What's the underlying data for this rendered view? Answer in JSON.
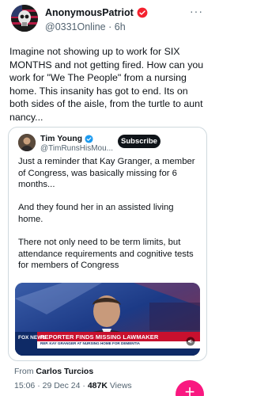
{
  "post": {
    "author_name": "AnonymousPatriot",
    "handle": "@0331Online",
    "separator": " · ",
    "time_ago": "6h",
    "text": "Imagine not showing up to work for SIX MONTHS and not getting fired. How can you work for \"We The People\" from a nursing home. This insanity has got to end. Its on both sides of the aisle, from the turtle to aunt nancy...",
    "more_icon": "more-icon",
    "verified_icon": "verified-red-badge-icon",
    "verified_color": "#f4212e"
  },
  "quote": {
    "author_name": "Tim Young",
    "handle": "@TimRunsHisMou...",
    "subscribe_label": "Subscribe",
    "verified_color": "#1d9bf0",
    "paragraphs": [
      "Just a reminder that Kay Granger, a member of Congress, was basically missing for 6 months...",
      "And they found her in an assisted living home.",
      "There not only need to be term limits, but attendance requirements and cognitive tests for members of Congress"
    ],
    "video": {
      "headline": "REPORTER FINDS MISSING LAWMAKER",
      "subheadline": "REP. KAY GRANGER AT NURSING HOME FOR DEMENTIA",
      "network": "FOX NEWS",
      "volume_icon": "volume-icon"
    }
  },
  "footer": {
    "from_label": "From",
    "from_name": "Carlos Turcios",
    "timestamp": "15:06 · 29 Dec 24 · ",
    "views_count": "487K",
    "views_label": " Views"
  },
  "fab": {
    "label": "+",
    "color": "#f91880"
  }
}
